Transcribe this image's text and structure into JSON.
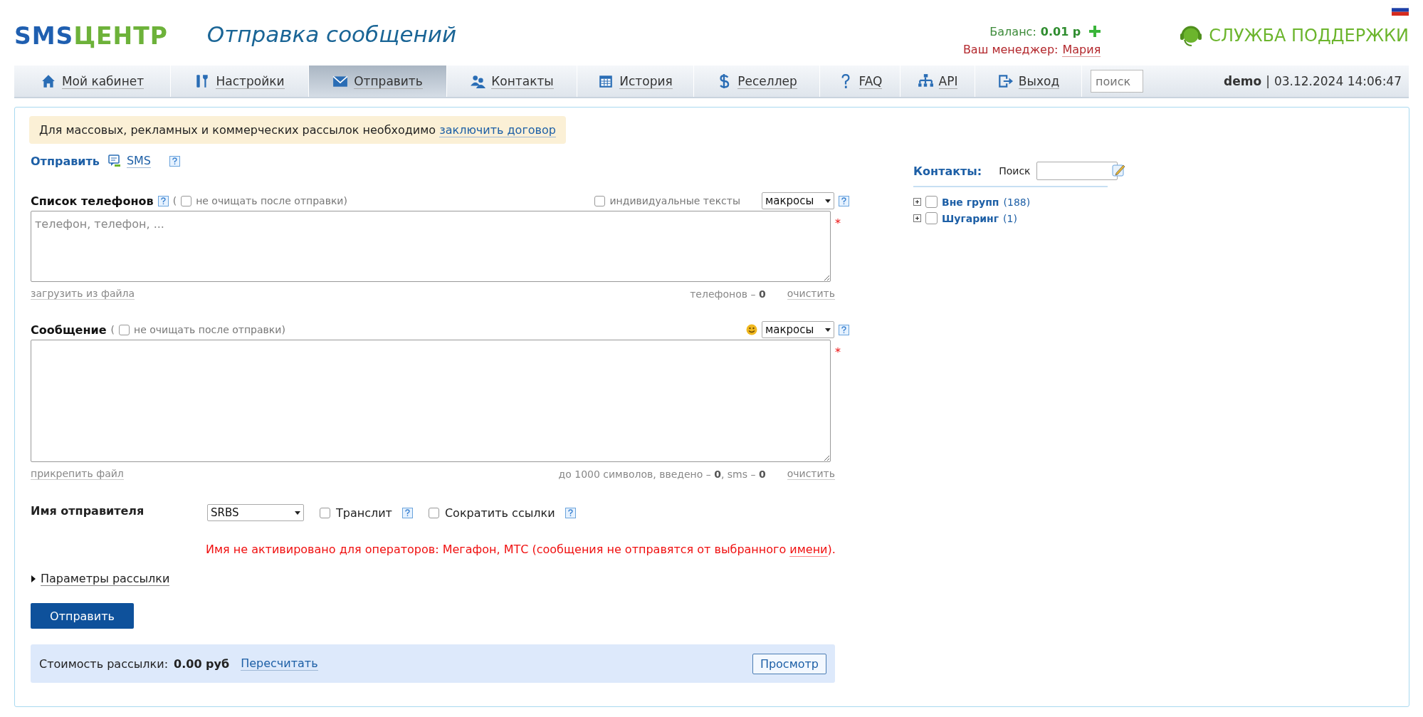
{
  "header": {
    "logo": {
      "part_1": "SMS",
      "part_2": "ЦЕНТР"
    },
    "title": "Отправка сообщений",
    "balance": {
      "label": "Баланс:",
      "value": "0.01 р"
    },
    "manager": {
      "label": "Ваш менеджер:",
      "name": "Мария"
    },
    "support": "СЛУЖБА ПОДДЕРЖКИ"
  },
  "nav": {
    "tabs": [
      {
        "label": "Мой кабинет",
        "selected": false
      },
      {
        "label": "Настройки",
        "selected": false
      },
      {
        "label": "Отправить",
        "selected": true
      },
      {
        "label": "Контакты",
        "selected": false
      },
      {
        "label": "История",
        "selected": false
      },
      {
        "label": "Реселлер",
        "selected": false
      },
      {
        "label": "FAQ",
        "selected": false
      },
      {
        "label": "API",
        "selected": false
      },
      {
        "label": "Выход",
        "selected": false
      }
    ],
    "search": {
      "placeholder": "поиск"
    },
    "user": "demo",
    "separator": "|",
    "datetime": "03.12.2024 14:06:47"
  },
  "notice": {
    "text": "Для массовых, рекламных и коммерческих рассылок необходимо",
    "link": "заключить договор"
  },
  "send_type": {
    "label": "Отправить",
    "type": "SMS"
  },
  "phones": {
    "label": "Список телефонов",
    "open_paren": "(",
    "keep": {
      "label": "не очищать после отправки",
      "checked": false
    },
    "close_paren": ")",
    "individual": {
      "label": "индивидуальные тексты",
      "checked": false
    },
    "macros": "макросы",
    "placeholder": "телефон, телефон, ...",
    "required": "*",
    "upload": "загрузить из файла",
    "count_label": "телефонов –",
    "count": "0",
    "clear": "очистить"
  },
  "message": {
    "label": "Сообщение",
    "open_paren": "(",
    "keep": {
      "label": "не очищать после отправки",
      "checked": false
    },
    "close_paren": ")",
    "macros": "макросы",
    "required": "*",
    "attach": "прикрепить файл",
    "counter": "до 1000 символов, введено – **0**, sms – **0**",
    "clear": "очистить"
  },
  "sender": {
    "label": "Имя отправителя",
    "value": "SRBS",
    "options": [
      {
        "label": "Транслит",
        "checked": false
      },
      {
        "label": "Сократить ссылки",
        "checked": false
      }
    ]
  },
  "error": {
    "text": "Имя не активировано для операторов: Мегафон, МТС (сообщения не отправятся от выбранного",
    "link": "имени",
    "tail": ")."
  },
  "params": {
    "label": "Параметры рассылки",
    "expanded": false
  },
  "submit": "Отправить",
  "cost": {
    "label": "Стоимость рассылки:",
    "value": "0.00 руб",
    "recalc": "Пересчитать",
    "preview": "Просмотр"
  },
  "contacts": {
    "title": "Контакты:",
    "search_label": "Поиск",
    "groups": [
      {
        "name": "Вне групп",
        "count": "(188)",
        "checked": false,
        "expanded": false
      },
      {
        "name": "Шугаринг",
        "count": "(1)",
        "checked": false,
        "expanded": false
      }
    ]
  }
}
